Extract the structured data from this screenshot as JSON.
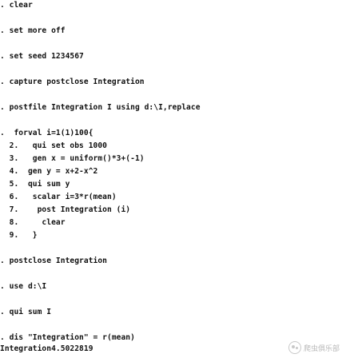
{
  "console": {
    "lines": [
      ". clear",
      ". set more off",
      ". set seed 1234567",
      ". capture postclose Integration",
      ". postfile Integration I using d:\\I,replace",
      ".  forval i=1(1)100{",
      "  2.   qui set obs 1000",
      "  3.   gen x = uniform()*3+(-1)",
      "  4.  gen y = x+2-x^2",
      "  5.  qui sum y",
      "  6.   scalar i=3*r(mean)",
      "  7.    post Integration (i)",
      "  8.     clear",
      "  9.   }",
      ". postclose Integration",
      ". use d:\\I",
      ". qui sum I",
      ". dis \"Integration\" = r(mean)",
      "Integration4.5022819"
    ]
  },
  "watermark": {
    "icon": "wechat-bubble-icon",
    "text": "爬虫俱乐部"
  }
}
